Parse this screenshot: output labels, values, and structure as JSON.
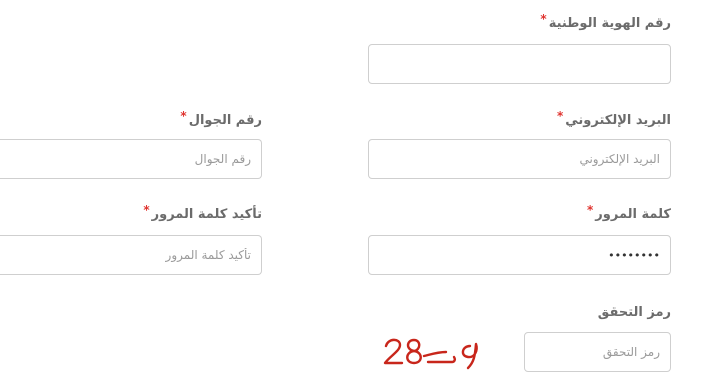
{
  "form": {
    "national_id": {
      "label": "رقم الهوية الوطنية",
      "required_mark": "*",
      "value": "",
      "placeholder": ""
    },
    "email": {
      "label": "البريد الإلكتروني",
      "required_mark": "*",
      "value": "",
      "placeholder": "البريد الإلكتروني"
    },
    "mobile": {
      "label": "رقم الجوال",
      "required_mark": "*",
      "value": "",
      "placeholder": "رقم الجوال"
    },
    "password": {
      "label": "كلمة المرور",
      "required_mark": "*",
      "value": "••••••••",
      "placeholder": ""
    },
    "confirm_password": {
      "label": "تأكيد كلمة المرور",
      "required_mark": "*",
      "value": "",
      "placeholder": "تأكيد كلمة المرور"
    },
    "captcha": {
      "label": "رمز التحقق",
      "value": "",
      "placeholder": "رمز التحقق",
      "image_text": "28ح9"
    }
  },
  "colors": {
    "label": "#6b6b6b",
    "required": "#e0342f",
    "border": "#cfcfcf",
    "captcha": "#c8261b"
  }
}
